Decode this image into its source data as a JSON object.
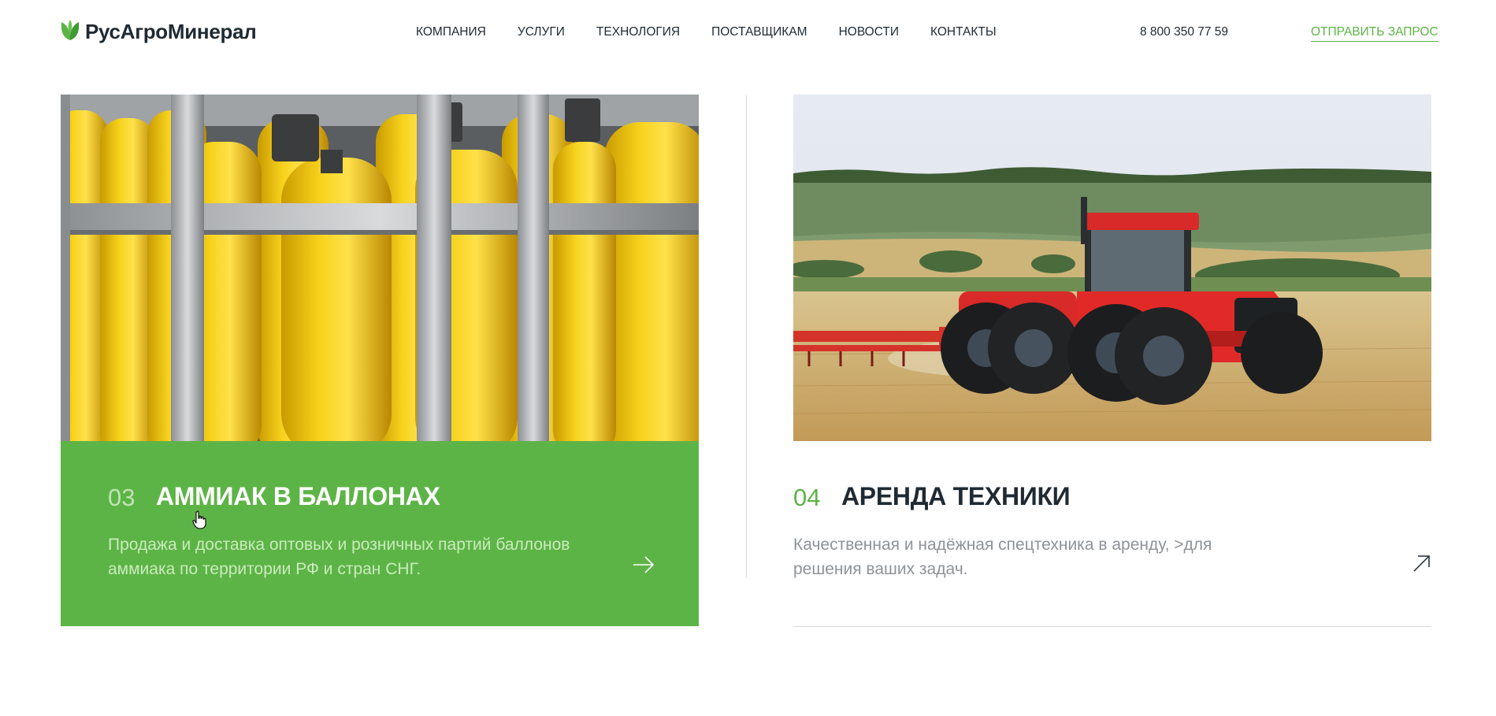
{
  "header": {
    "logo_text": "РусАгроМинерал",
    "nav": [
      {
        "label": "КОМПАНИЯ"
      },
      {
        "label": "УСЛУГИ"
      },
      {
        "label": "ТЕХНОЛОГИЯ"
      },
      {
        "label": "ПОСТАВЩИКАМ"
      },
      {
        "label": "НОВОСТИ"
      },
      {
        "label": "КОНТАКТЫ"
      }
    ],
    "phone": "8 800 350 77 59",
    "request_label": "ОТПРАВИТЬ ЗАПРОС"
  },
  "services": [
    {
      "number": "03",
      "title": "АММИАК В БАЛЛОНАХ",
      "description": "Продажа и доставка оптовых и розничных партий баллонов аммиака по территории РФ и стран СНГ.",
      "image": "yellow-gas-cylinders",
      "active": true
    },
    {
      "number": "04",
      "title": "АРЕНДА ТЕХНИКИ",
      "description": "Качественная и надёжная спецтехника в аренду, >для решения ваших задач.",
      "image": "red-tractor-in-field",
      "active": false
    }
  ],
  "colors": {
    "accent": "#5db446",
    "text": "#1f2a33",
    "muted": "#8e9399"
  },
  "icons": [
    "logo-leaf-icon",
    "arrow-right-icon",
    "arrow-up-right-icon",
    "hand-cursor-icon"
  ]
}
